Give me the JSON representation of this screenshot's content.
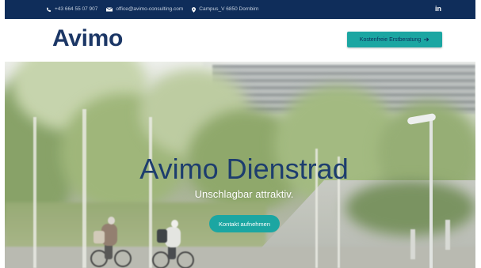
{
  "colors": {
    "topbar_background": "#0f2d5a",
    "brand_navy": "#1c3766",
    "accent_teal": "#1ba6a2",
    "hero_title": "#1d3d6e",
    "hero_subtitle": "#ffffff"
  },
  "topbar": {
    "phone": {
      "icon": "phone-icon",
      "text": "+43 664 55 07 907"
    },
    "email": {
      "icon": "envelope-icon",
      "text": "office@avimo-consulting.com"
    },
    "address": {
      "icon": "map-pin-icon",
      "text": "Campus_V 6850 Dornbirn"
    },
    "social": {
      "icon": "linkedin-icon",
      "text": "in"
    }
  },
  "header": {
    "logo": "Avimo",
    "cta": {
      "label": "Kostenfreie Erstberatung",
      "icon": "arrow-right-icon"
    }
  },
  "hero": {
    "title": "Avimo Dienstrad",
    "subtitle": "Unschlagbar attraktiv.",
    "button": "Kontakt aufnehmen"
  }
}
